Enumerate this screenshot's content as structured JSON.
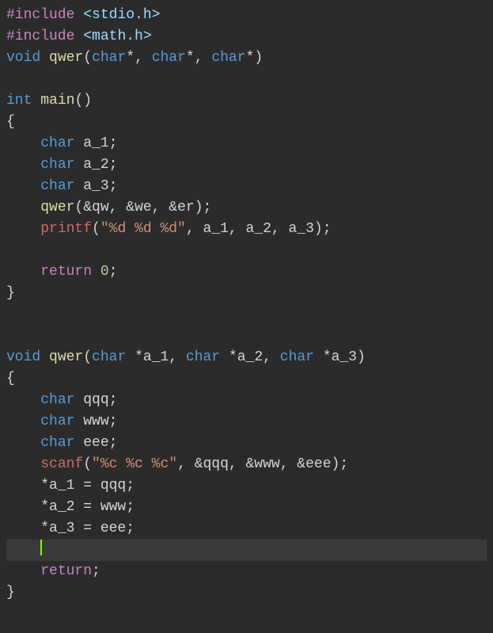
{
  "code": {
    "l01a": "#include",
    "l01b": "<stdio.h>",
    "l02a": "#include",
    "l02b": "<math.h>",
    "l03a": "void",
    "l03b": "qwer",
    "l03c": "char",
    "l03d": "char",
    "l03e": "char",
    "l05a": "int",
    "l05b": "main",
    "l07a": "char",
    "l07b": "a_1",
    "l08a": "char",
    "l08b": "a_2",
    "l09a": "char",
    "l09b": "a_3",
    "l10a": "qwer",
    "l10b": "qw",
    "l10c": "we",
    "l10d": "er",
    "l11a": "printf",
    "l11b": "\"%d %d %d\"",
    "l11c": "a_1",
    "l11d": "a_2",
    "l11e": "a_3",
    "l13a": "return",
    "l13b": "0",
    "l17a": "void",
    "l17b": "qwer",
    "l17c": "char",
    "l17d": "a_1",
    "l17e": "char",
    "l17f": "a_2",
    "l17g": "char",
    "l17h": "a_3",
    "l19a": "char",
    "l19b": "qqq",
    "l20a": "char",
    "l20b": "www",
    "l21a": "char",
    "l21b": "eee",
    "l22a": "scanf",
    "l22b": "\"%c %c %c\"",
    "l22c": "qqq",
    "l22d": "www",
    "l22e": "eee",
    "l23a": "a_1",
    "l23b": "qqq",
    "l24a": "a_2",
    "l24b": "www",
    "l25a": "a_3",
    "l25b": "eee",
    "l27a": "return"
  }
}
